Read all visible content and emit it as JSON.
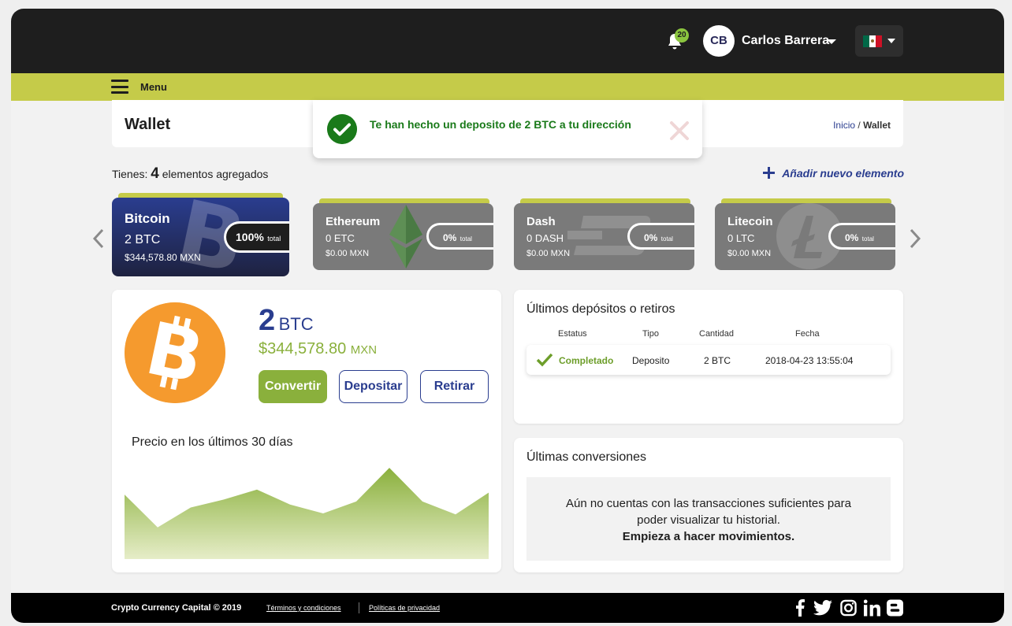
{
  "header": {
    "notifications_count": "20",
    "user_initials": "CB",
    "user_name": "Carlos Barrera",
    "flag_colors": [
      "#006847",
      "#ffffff",
      "#ce1126"
    ]
  },
  "menu": {
    "label": "Menu"
  },
  "page": {
    "title": "Wallet",
    "breadcrumb_home": "Inicio",
    "breadcrumb_sep": " / ",
    "breadcrumb_current": "Wallet"
  },
  "toast": {
    "message": "Te han hecho un deposito de 2 BTC a tu dirección"
  },
  "summary": {
    "prefix": "Tienes: ",
    "count": "4",
    "suffix": " elementos agregados",
    "add_label": "Añadir nuevo elemento"
  },
  "cards": [
    {
      "name": "Bitcoin",
      "amount": "2 BTC",
      "fiat": "$344,578.80 MXN",
      "percent": "100%",
      "total_label": "total",
      "icon": "bitcoin-icon",
      "active": true,
      "color": "#2a3d8f"
    },
    {
      "name": "Ethereum",
      "amount": "0 ETC",
      "fiat": "$0.00  MXN",
      "percent": "0%",
      "total_label": "total",
      "icon": "ethereum-icon",
      "active": false,
      "color": "#7a7a7a"
    },
    {
      "name": "Dash",
      "amount": "0 DASH",
      "fiat": "$0.00  MXN",
      "percent": "0%",
      "total_label": "total",
      "icon": "dash-icon",
      "active": false,
      "color": "#7a7a7a"
    },
    {
      "name": "Litecoin",
      "amount": "0 LTC",
      "fiat": "$0.00  MXN",
      "percent": "0%",
      "total_label": "total",
      "icon": "litecoin-icon",
      "active": false,
      "color": "#7a7a7a"
    }
  ],
  "detail": {
    "amount": "2",
    "unit": "BTC",
    "fiat": "$344,578.80",
    "fiat_unit": "MXN",
    "buttons": {
      "convert": "Convertir",
      "deposit": "Depositar",
      "withdraw": "Retirar"
    },
    "chart_title": "Precio en los últimos 30 días"
  },
  "chart_data": {
    "type": "area",
    "title": "Precio en los últimos 30 días",
    "xlabel": "",
    "ylabel": "",
    "values": [
      35,
      68,
      48,
      40,
      30,
      45,
      54,
      42,
      8,
      42,
      55,
      33
    ],
    "ylim": [
      100,
      0
    ],
    "color": "#8ab03c"
  },
  "deposits": {
    "title": "Últimos depósitos o retiros",
    "columns": [
      "Estatus",
      "Tipo",
      "Cantidad",
      "Fecha"
    ],
    "rows": [
      {
        "status": "Completado",
        "type": "Deposito",
        "amount": "2 BTC",
        "date": "2018-04-23 13:55:04"
      }
    ]
  },
  "conversions": {
    "title": "Últimas conversiones",
    "empty_line1": "Aún no cuentas con las transacciones suficientes para",
    "empty_line2": "poder visualizar tu historial.",
    "empty_cta": "Empieza a hacer movimientos."
  },
  "footer": {
    "copyright": "Crypto Currency Capital © 2019",
    "terms": "Términos y condiciones",
    "privacy": "Políticas de privacidad"
  }
}
